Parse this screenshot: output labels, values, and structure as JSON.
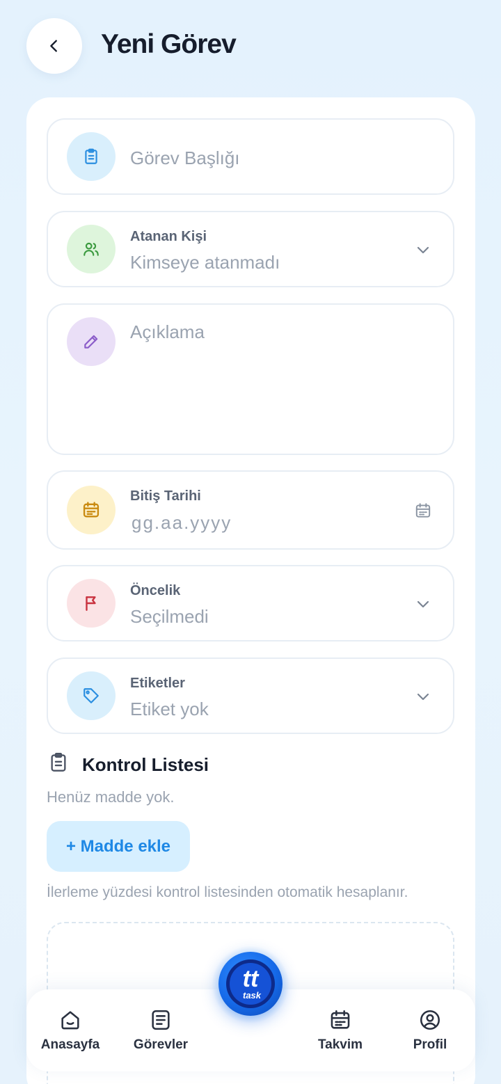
{
  "header": {
    "title": "Yeni Görev"
  },
  "form": {
    "title_field": {
      "placeholder": "Görev Başlığı"
    },
    "assignee": {
      "label": "Atanan Kişi",
      "value": "Kimseye atanmadı"
    },
    "description": {
      "placeholder": "Açıklama"
    },
    "due_date": {
      "label": "Bitiş Tarihi",
      "value": "gg.aa.yyyy"
    },
    "priority": {
      "label": "Öncelik",
      "value": "Seçilmedi"
    },
    "tags": {
      "label": "Etiketler",
      "value": "Etiket yok"
    }
  },
  "checklist": {
    "title": "Kontrol Listesi",
    "empty_text": "Henüz madde yok.",
    "add_label": "+ Madde ekle",
    "hint": "İlerleme yüzdesi kontrol listesinden otomatik hesaplanır."
  },
  "bottom_nav": {
    "items": [
      {
        "label": "Anasayfa",
        "icon": "home-icon"
      },
      {
        "label": "Görevler",
        "icon": "tasks-icon"
      },
      {
        "label": "Takvim",
        "icon": "calendar-icon"
      },
      {
        "label": "Profil",
        "icon": "profile-icon"
      }
    ],
    "fab": {
      "logo_text": "tt",
      "logo_sub": "task"
    }
  },
  "colors": {
    "accent": "#1e88e5",
    "title_icon_bg": "#d9effc",
    "assignee_icon_bg": "#def5dc",
    "description_icon_bg": "#eadff7",
    "date_icon_bg": "#fdf1c9",
    "priority_icon_bg": "#fbe3e5",
    "tags_icon_bg": "#d9effc"
  }
}
